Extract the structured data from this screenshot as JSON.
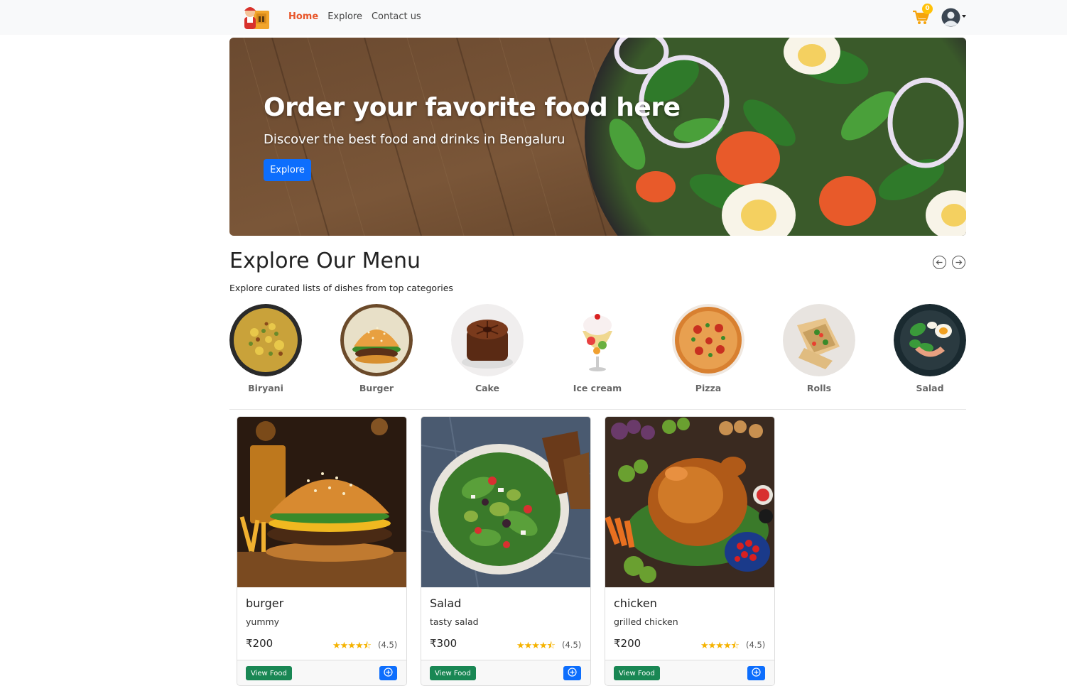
{
  "navbar": {
    "links": [
      {
        "label": "Home",
        "active": true
      },
      {
        "label": "Explore",
        "active": false
      },
      {
        "label": "Contact us",
        "active": false
      }
    ],
    "cart_count": "0",
    "logo_icon": "delivery-man-logo",
    "cart_icon": "shopping-cart-icon",
    "avatar_icon": "user-avatar-icon"
  },
  "hero": {
    "title": "Order your favorite food here",
    "subtitle": "Discover the best food and drinks in Bengaluru",
    "button_label": "Explore"
  },
  "menu": {
    "title": "Explore Our Menu",
    "description": "Explore curated lists of dishes from top categories",
    "categories": [
      {
        "label": "Biryani"
      },
      {
        "label": "Burger"
      },
      {
        "label": "Cake"
      },
      {
        "label": "Ice cream"
      },
      {
        "label": "Pizza"
      },
      {
        "label": "Rolls"
      },
      {
        "label": "Salad"
      }
    ]
  },
  "foods": [
    {
      "name": "burger",
      "description": "yummy",
      "price": "₹200",
      "stars": "★★★★⯪",
      "rating": "(4.5)",
      "view_label": "View Food"
    },
    {
      "name": "Salad",
      "description": "tasty salad",
      "price": "₹300",
      "stars": "★★★★⯪",
      "rating": "(4.5)",
      "view_label": "View Food"
    },
    {
      "name": "chicken",
      "description": "grilled chicken",
      "price": "₹200",
      "stars": "★★★★⯪",
      "rating": "(4.5)",
      "view_label": "View Food"
    }
  ],
  "colors": {
    "accent": "#e8572b",
    "primary": "#0d6efd",
    "success": "#198754",
    "star": "#f5b301",
    "badge": "#ffc107"
  }
}
